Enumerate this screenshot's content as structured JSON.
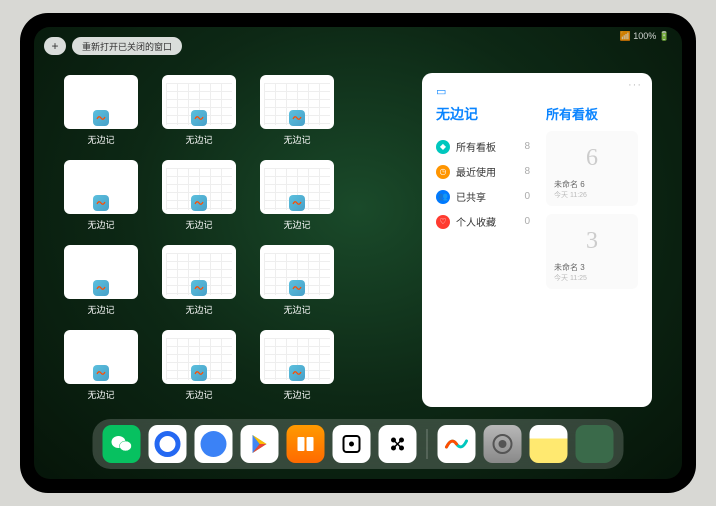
{
  "status": {
    "indicators": "📶 100% 🔋"
  },
  "pills": {
    "add": "+",
    "reopen": "重新打开已关闭的窗口"
  },
  "app_name": "无边记",
  "grid": [
    [
      {
        "label": "无边记",
        "variant": "blank"
      },
      {
        "label": "无边记",
        "variant": "cal"
      },
      {
        "label": "无边记",
        "variant": "cal"
      }
    ],
    [
      {
        "label": "无边记",
        "variant": "blank"
      },
      {
        "label": "无边记",
        "variant": "cal"
      },
      {
        "label": "无边记",
        "variant": "cal"
      }
    ],
    [
      {
        "label": "无边记",
        "variant": "blank"
      },
      {
        "label": "无边记",
        "variant": "cal"
      },
      {
        "label": "无边记",
        "variant": "cal"
      }
    ],
    [
      {
        "label": "无边记",
        "variant": "blank"
      },
      {
        "label": "无边记",
        "variant": "cal"
      },
      {
        "label": "无边记",
        "variant": "cal"
      }
    ]
  ],
  "panel": {
    "left_title": "无边记",
    "right_title": "所有看板",
    "dots": "···",
    "nav": [
      {
        "icon": "◆",
        "color": "ic-cyan",
        "label": "所有看板",
        "count": "8"
      },
      {
        "icon": "◷",
        "color": "ic-orange",
        "label": "最近使用",
        "count": "8"
      },
      {
        "icon": "👥",
        "color": "ic-blue",
        "label": "已共享",
        "count": "0"
      },
      {
        "icon": "♡",
        "color": "ic-red",
        "label": "个人收藏",
        "count": "0"
      }
    ],
    "boards": [
      {
        "sketch": "6",
        "name": "未命名 6",
        "date": "今天 11:26"
      },
      {
        "sketch": "3",
        "name": "未命名 3",
        "date": "今天 11:25"
      }
    ]
  },
  "dock": [
    {
      "name": "wechat"
    },
    {
      "name": "quark"
    },
    {
      "name": "qqbrowser"
    },
    {
      "name": "play"
    },
    {
      "name": "books"
    },
    {
      "name": "dice"
    },
    {
      "name": "game"
    },
    {
      "sep": true
    },
    {
      "name": "freeform"
    },
    {
      "name": "settings"
    },
    {
      "name": "notes"
    },
    {
      "name": "recent"
    }
  ]
}
